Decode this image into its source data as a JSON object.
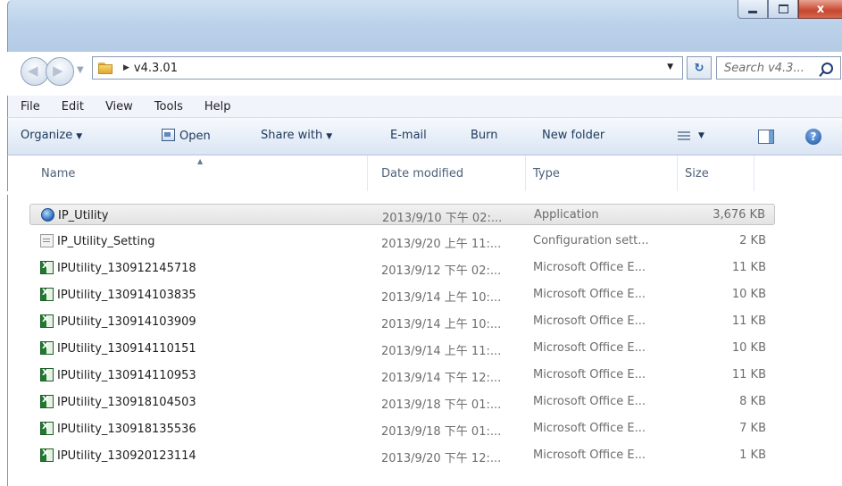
{
  "window": {
    "controls": {
      "minimize": "minimize-icon",
      "maximize": "maximize-icon",
      "close_glyph": "x"
    }
  },
  "address": {
    "crumb": "v4.3.01",
    "search_placeholder": "Search v4.3..."
  },
  "menu": [
    "File",
    "Edit",
    "View",
    "Tools",
    "Help"
  ],
  "toolbar": {
    "organize": "Organize",
    "open": "Open",
    "share": "Share with",
    "email": "E-mail",
    "burn": "Burn",
    "new_folder": "New folder",
    "help_glyph": "?"
  },
  "columns": {
    "name": "Name",
    "date": "Date modified",
    "type": "Type",
    "size": "Size"
  },
  "files": [
    {
      "name": "IP_Utility",
      "date": "2013/9/10 下午 02:...",
      "type": "Application",
      "size": "3,676 KB",
      "icon": "app",
      "selected": true
    },
    {
      "name": "IP_Utility_Setting",
      "date": "2013/9/20 上午 11:...",
      "type": "Configuration sett...",
      "size": "2 KB",
      "icon": "cfg"
    },
    {
      "name": "IPUtility_130912145718",
      "date": "2013/9/12 下午 02:...",
      "type": "Microsoft Office E...",
      "size": "11 KB",
      "icon": "xls"
    },
    {
      "name": "IPUtility_130914103835",
      "date": "2013/9/14 上午 10:...",
      "type": "Microsoft Office E...",
      "size": "10 KB",
      "icon": "xls"
    },
    {
      "name": "IPUtility_130914103909",
      "date": "2013/9/14 上午 10:...",
      "type": "Microsoft Office E...",
      "size": "11 KB",
      "icon": "xls"
    },
    {
      "name": "IPUtility_130914110151",
      "date": "2013/9/14 上午 11:...",
      "type": "Microsoft Office E...",
      "size": "10 KB",
      "icon": "xls"
    },
    {
      "name": "IPUtility_130914110953",
      "date": "2013/9/14 下午 12:...",
      "type": "Microsoft Office E...",
      "size": "11 KB",
      "icon": "xls"
    },
    {
      "name": "IPUtility_130918104503",
      "date": "2013/9/18 下午 01:...",
      "type": "Microsoft Office E...",
      "size": "8 KB",
      "icon": "xls"
    },
    {
      "name": "IPUtility_130918135536",
      "date": "2013/9/18 下午 01:...",
      "type": "Microsoft Office E...",
      "size": "7 KB",
      "icon": "xls"
    },
    {
      "name": "IPUtility_130920123114",
      "date": "2013/9/20 下午 12:...",
      "type": "Microsoft Office E...",
      "size": "1 KB",
      "icon": "xls"
    }
  ]
}
